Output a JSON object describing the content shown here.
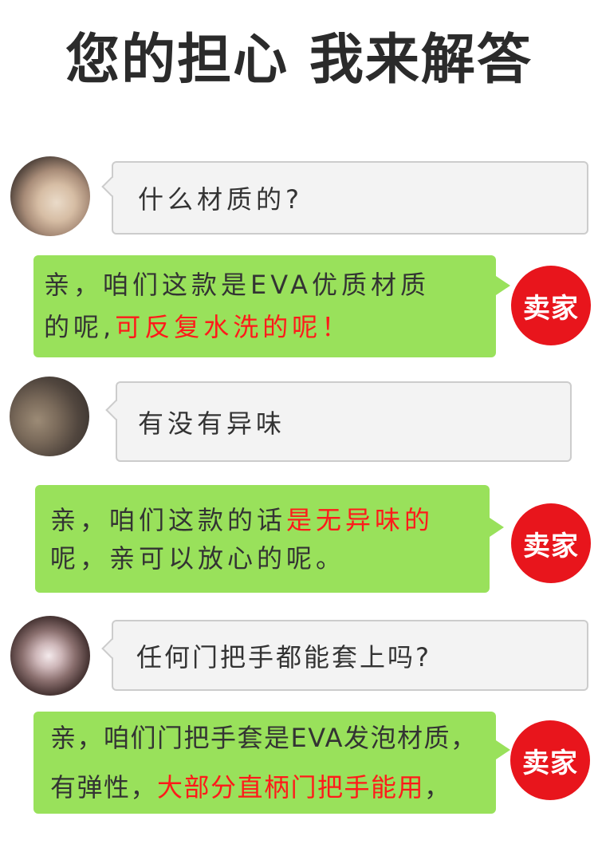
{
  "page": {
    "title": "您的担心 我来解答"
  },
  "colors": {
    "text": "#333333",
    "highlight": "#ff1a1a",
    "seller_bubble": "#99e15b",
    "buyer_bubble": "#f3f3f3",
    "buyer_border": "#cccccc",
    "seller_badge": "#e8151c",
    "badge_text": "#ffffff"
  },
  "conversation": [
    {
      "lines": [
        [
          {
            "text": "什么材质的?",
            "color": "#333333"
          }
        ]
      ]
    },
    {
      "badge": "卖家",
      "lines": [
        [
          {
            "text": "亲，咱们这款是EVA优质材质",
            "color": "#333333"
          }
        ],
        [
          {
            "text": "的呢,",
            "color": "#333333"
          },
          {
            "text": "可反复水洗的呢！",
            "color": "#ff1a1a"
          }
        ]
      ]
    },
    {
      "lines": [
        [
          {
            "text": "有没有异味",
            "color": "#333333"
          }
        ]
      ]
    },
    {
      "badge": "卖家",
      "lines": [
        [
          {
            "text": "亲，咱们这款的话",
            "color": "#333333"
          },
          {
            "text": "是无异味的",
            "color": "#ff1a1a"
          }
        ],
        [
          {
            "text": "呢，亲可以放心的呢。",
            "color": "#333333"
          }
        ]
      ]
    },
    {
      "lines": [
        [
          {
            "text": "任何门把手都能套上吗?",
            "color": "#333333"
          }
        ]
      ]
    },
    {
      "badge": "卖家",
      "lines": [
        [
          {
            "text": "亲，咱们门把手套是EVA发泡材质，",
            "color": "#333333"
          }
        ],
        [
          {
            "text": "有弹性，",
            "color": "#333333"
          },
          {
            "text": "大部分直柄门把手能用",
            "color": "#ff1a1a"
          },
          {
            "text": "，",
            "color": "#333333"
          }
        ]
      ]
    }
  ]
}
